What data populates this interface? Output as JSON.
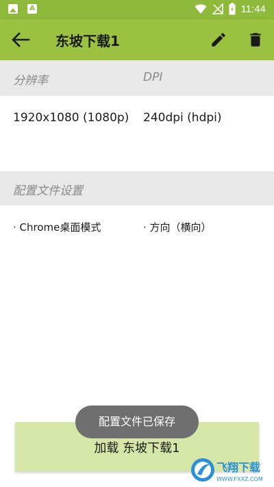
{
  "status_bar": {
    "time": "11:44"
  },
  "toolbar": {
    "title": "东坡下载1"
  },
  "display_section": {
    "resolution_label": "分辨率",
    "dpi_label": "DPI",
    "resolution_value": "1920x1080 (1080p)",
    "dpi_value": "240dpi (hdpi)"
  },
  "profile_section": {
    "header": "配置文件设置",
    "setting_1": "· Chrome桌面模式",
    "setting_2": "· 方向（横向）"
  },
  "load_button": {
    "label": "加载 东坡下载1"
  },
  "toast": {
    "message": "配置文件已保存"
  },
  "watermark": {
    "text": "飞翔下载",
    "url": "WWW.FXXZ.COM"
  },
  "colors": {
    "toolbar": "#9ac240",
    "status_bar": "#8fb93a",
    "header_bg": "#e8e8e8",
    "button_bg": "#d5e6a6",
    "toast_bg": "#6f6f6f"
  },
  "icons": [
    "image-icon",
    "a-icon",
    "wifi-icon",
    "no-signal-icon",
    "battery-icon",
    "back-arrow-icon",
    "edit-pencil-icon",
    "delete-trash-icon"
  ]
}
